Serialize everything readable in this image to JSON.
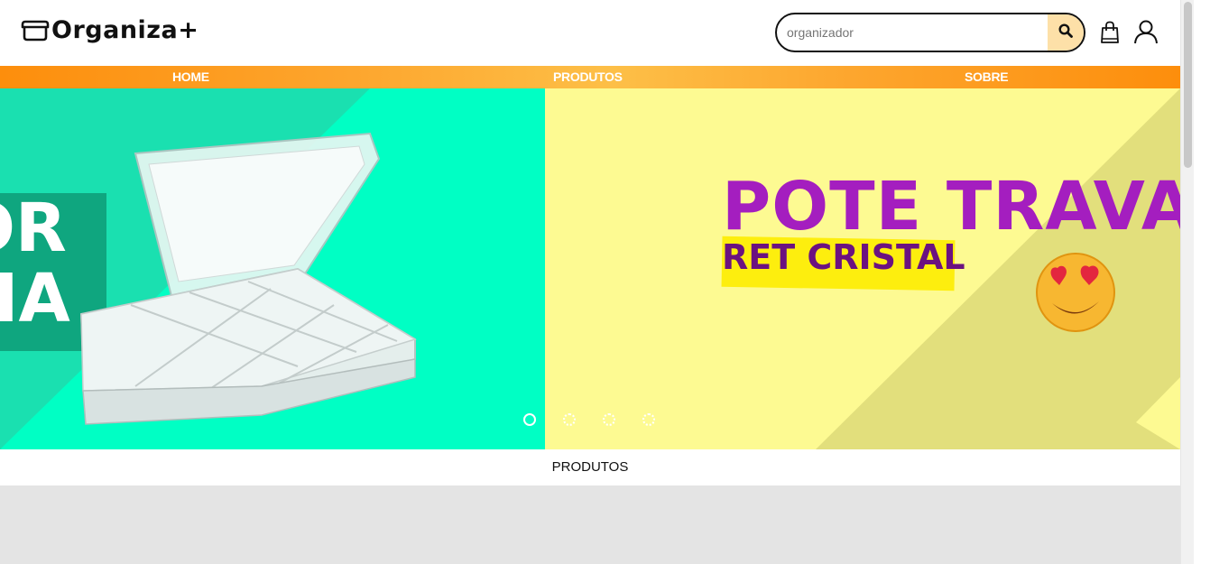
{
  "brand": {
    "logo_text": "Organiza+"
  },
  "search": {
    "placeholder": "organizador",
    "value": ""
  },
  "nav": {
    "items": [
      "HOME",
      "PRODUTOS",
      "SOBRE"
    ]
  },
  "banner": {
    "left_slide": {
      "partial_text": [
        "OR",
        "RIA"
      ]
    },
    "right_slide": {
      "title": "POTE TRAVA",
      "subtitle": "RET CRISTAL"
    },
    "slide_count": 4,
    "active_slide": 1
  },
  "section": {
    "title": "PRODUTOS"
  },
  "colors": {
    "accent_orange": "#fd8e0c",
    "banner_left_bg": "#00ffc4",
    "banner_right_bg": "#fdfa92",
    "purple_text": "#a41ebf",
    "yellow_highlight": "#fdee0e",
    "search_button_bg": "#fde0a8"
  },
  "icons": [
    "box-logo-icon",
    "search-icon",
    "shopping-bag-icon",
    "user-icon"
  ]
}
